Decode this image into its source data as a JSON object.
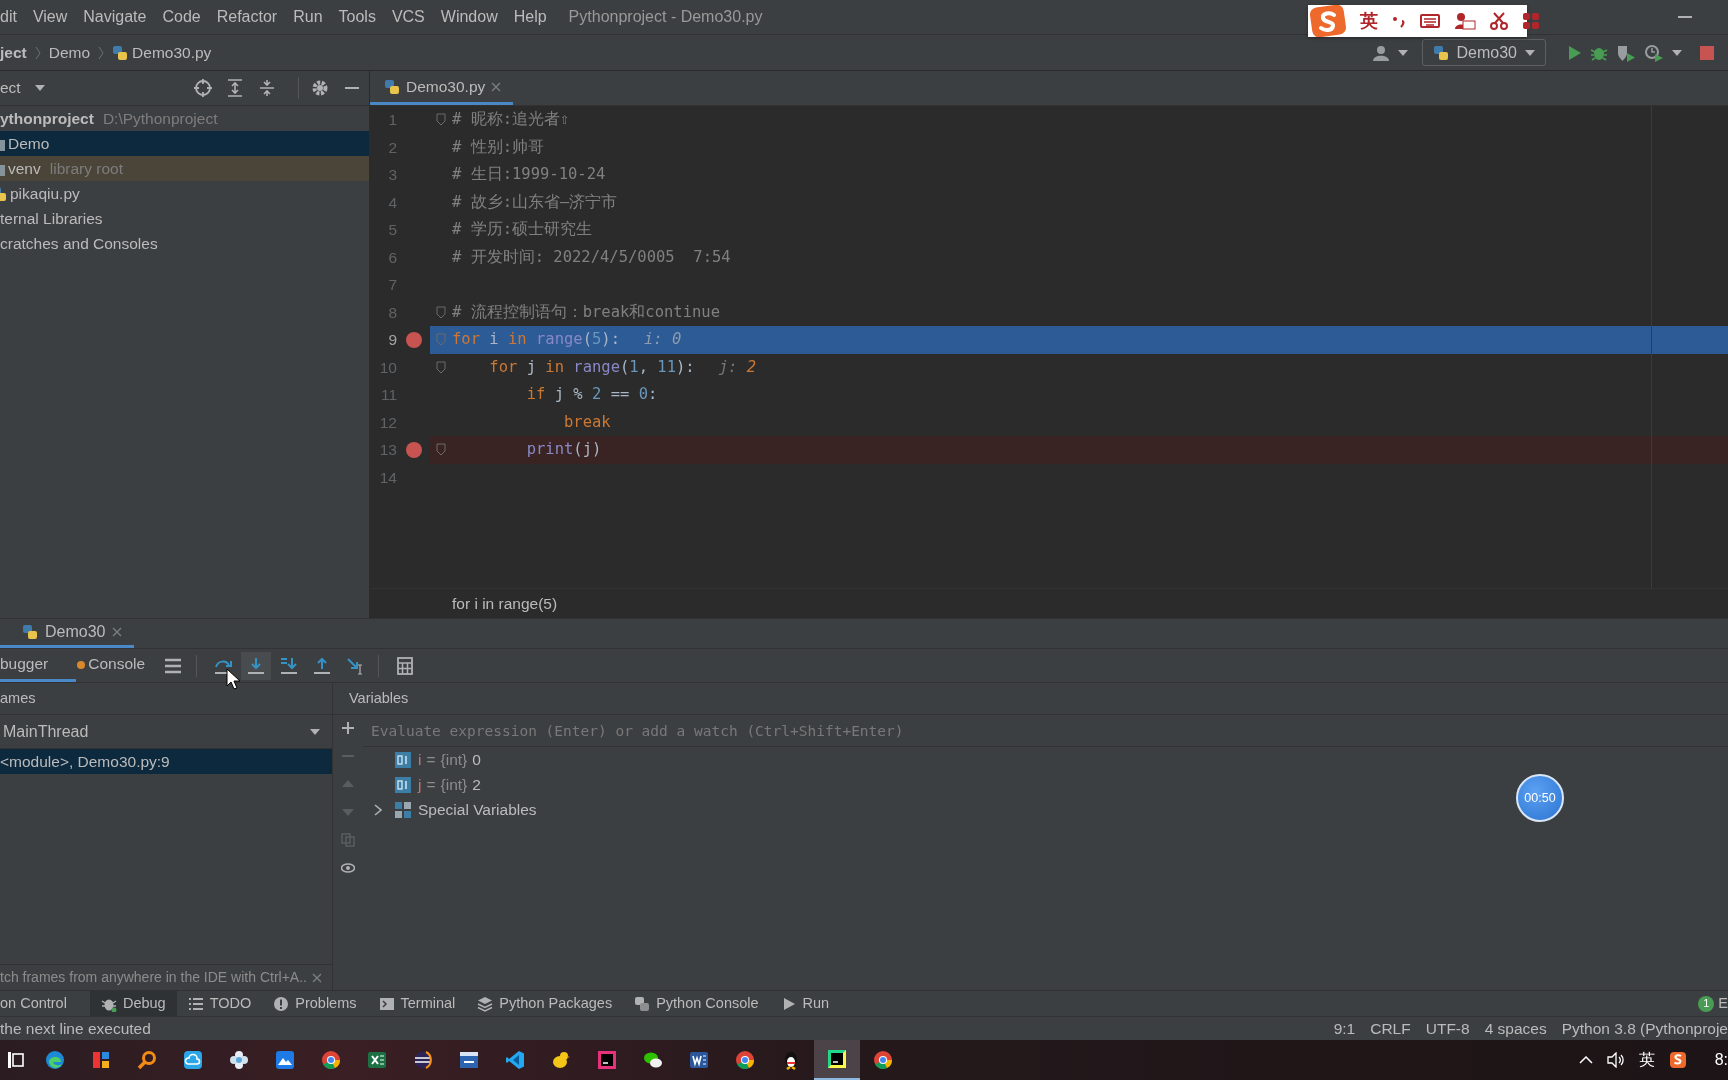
{
  "menu": [
    {
      "label": "dit"
    },
    {
      "label": "View"
    },
    {
      "label": "Navigate"
    },
    {
      "label": "Code"
    },
    {
      "label": "Refactor"
    },
    {
      "label": "Run"
    },
    {
      "label": "Tools"
    },
    {
      "label": "VCS"
    },
    {
      "label": "Window"
    },
    {
      "label": "Help"
    }
  ],
  "window_title": "Pythonproject - Demo30.py",
  "ime_toolbar": {
    "mode": "英"
  },
  "breadcrumbs": [
    {
      "label": "ject",
      "kind": "project"
    },
    {
      "label": "Demo",
      "kind": "folder"
    },
    {
      "label": "Demo30.py",
      "kind": "file"
    }
  ],
  "run_configuration": "Demo30",
  "project_panel": {
    "title": "ect",
    "tree": [
      {
        "label": "ythonproject",
        "path": "D:\\Pythonproject",
        "kind": "project",
        "selected": false,
        "children": [
          {
            "label": "Demo",
            "kind": "folder",
            "selected": true
          },
          {
            "label": "venv",
            "note": "library root",
            "kind": "library",
            "selected": false
          },
          {
            "label": "pikaqiu.py",
            "kind": "file",
            "selected": false
          }
        ]
      },
      {
        "label": "ternal Libraries",
        "kind": "libraries",
        "selected": false
      },
      {
        "label": "cratches and Consoles",
        "kind": "scratches",
        "selected": false
      }
    ]
  },
  "editor": {
    "tabs": [
      {
        "label": "Demo30.py",
        "selected": true
      }
    ],
    "lines": [
      {
        "number": "1",
        "fold": true,
        "breakpoint": false,
        "current": false,
        "code": [
          {
            "kind": "comment",
            "text": "# 昵称:追光者⇧"
          }
        ]
      },
      {
        "number": "2",
        "fold": false,
        "breakpoint": false,
        "current": false,
        "code": [
          {
            "kind": "comment",
            "text": "# 性别:帅哥"
          }
        ]
      },
      {
        "number": "3",
        "fold": false,
        "breakpoint": false,
        "current": false,
        "code": [
          {
            "kind": "comment",
            "text": "# 生日:1999-10-24"
          }
        ]
      },
      {
        "number": "4",
        "fold": false,
        "breakpoint": false,
        "current": false,
        "code": [
          {
            "kind": "comment",
            "text": "# 故乡:山东省—济宁市"
          }
        ]
      },
      {
        "number": "5",
        "fold": false,
        "breakpoint": false,
        "current": false,
        "code": [
          {
            "kind": "comment",
            "text": "# 学历:硕士研究生"
          }
        ]
      },
      {
        "number": "6",
        "fold": false,
        "breakpoint": false,
        "current": false,
        "code": [
          {
            "kind": "comment",
            "text": "# 开发时间: 2022/4/5/0005  7:54"
          }
        ]
      },
      {
        "number": "7",
        "fold": false,
        "breakpoint": false,
        "current": false
      },
      {
        "number": "8",
        "fold": true,
        "breakpoint": false,
        "current": false,
        "code": [
          {
            "kind": "comment",
            "text": "# 流程控制语句：break和continue"
          }
        ]
      },
      {
        "number": "9",
        "fold": true,
        "breakpoint": true,
        "current": true,
        "code": [
          {
            "kind": "keyword",
            "text": "for"
          },
          {
            "kind": "plain",
            "text": " i "
          },
          {
            "kind": "keyword",
            "text": "in"
          },
          {
            "kind": "builtin",
            "text": " range"
          },
          {
            "kind": "plain",
            "text": "("
          },
          {
            "kind": "number",
            "text": "5"
          },
          {
            "kind": "plain",
            "text": "):"
          }
        ],
        "hint": {
          "name": "i: ",
          "value": "0"
        }
      },
      {
        "number": "10",
        "fold": true,
        "breakpoint": false,
        "current": false,
        "code": [
          {
            "kind": "keyword",
            "text": "    for"
          },
          {
            "kind": "plain",
            "text": " j "
          },
          {
            "kind": "keyword",
            "text": "in"
          },
          {
            "kind": "builtin",
            "text": " range"
          },
          {
            "kind": "plain",
            "text": "("
          },
          {
            "kind": "number",
            "text": "1"
          },
          {
            "kind": "plain",
            "text": ", "
          },
          {
            "kind": "number",
            "text": "11"
          },
          {
            "kind": "plain",
            "text": "):"
          }
        ],
        "hint": {
          "name": "j: ",
          "value": "2"
        }
      },
      {
        "number": "11",
        "fold": false,
        "breakpoint": false,
        "current": false,
        "code": [
          {
            "kind": "keyword",
            "text": "        if"
          },
          {
            "kind": "plain",
            "text": " j % "
          },
          {
            "kind": "number",
            "text": "2"
          },
          {
            "kind": "plain",
            "text": " == "
          },
          {
            "kind": "number",
            "text": "0"
          },
          {
            "kind": "plain",
            "text": ":"
          }
        ]
      },
      {
        "number": "12",
        "fold": false,
        "breakpoint": false,
        "current": false,
        "code": [
          {
            "kind": "keyword",
            "text": "            break"
          }
        ]
      },
      {
        "number": "13",
        "fold": true,
        "breakpoint": true,
        "current": false,
        "code": [
          {
            "kind": "builtin",
            "text": "        print"
          },
          {
            "kind": "plain",
            "text": "(j)"
          }
        ]
      },
      {
        "number": "14",
        "fold": false,
        "breakpoint": false,
        "current": false
      }
    ],
    "breadcrumb": "for i in range(5)"
  },
  "debug": {
    "tabs": [
      {
        "label": "Demo30",
        "selected": true
      }
    ],
    "subtabs": [
      {
        "label": "bugger",
        "selected": true
      },
      {
        "label": "Console",
        "selected": false
      }
    ],
    "frames_title": "ames",
    "thread": "MainThread",
    "frames": [
      {
        "label": "<module>, Demo30.py:9",
        "selected": true
      }
    ],
    "variables_title": "Variables",
    "evaluate": {
      "placeholder": "Evaluate expression (Enter) or add a watch (Ctrl+Shift+Enter)"
    },
    "variables": [
      {
        "kind": "value",
        "name": "i",
        "separator": "=",
        "type": "{int}",
        "value": "0"
      },
      {
        "kind": "value",
        "name": "j",
        "separator": "=",
        "type": "{int}",
        "value": "2"
      },
      {
        "kind": "group",
        "name": "Special Variables",
        "expanded": false
      }
    ],
    "hint": "tch frames from anywhere in the IDE with Ctrl+A.."
  },
  "timer": "00:50",
  "tool_windows": [
    {
      "label": "on Control",
      "kind": "vcs",
      "selected": false
    },
    {
      "label": "Debug",
      "kind": "debug",
      "selected": true
    },
    {
      "label": "TODO",
      "kind": "todo",
      "selected": false
    },
    {
      "label": "Problems",
      "kind": "problems",
      "selected": false
    },
    {
      "label": "Terminal",
      "kind": "terminal",
      "selected": false
    },
    {
      "label": "Python Packages",
      "kind": "packages",
      "selected": false
    },
    {
      "label": "Python Console",
      "kind": "console",
      "selected": false
    },
    {
      "label": "Run",
      "kind": "run",
      "selected": false
    }
  ],
  "event_log": {
    "count": "1",
    "label": "E"
  },
  "status": {
    "message": "the next line executed",
    "items": [
      "9:1",
      "CRLF",
      "UTF-8",
      "4 spaces",
      "Python 3.8 (Pythonproje"
    ]
  },
  "taskbar": {
    "apps": [
      {
        "kind": "taskview",
        "selected": false
      },
      {
        "kind": "edge",
        "selected": false
      },
      {
        "kind": "tiles",
        "selected": false
      },
      {
        "kind": "search",
        "selected": false
      },
      {
        "kind": "cloud",
        "selected": false
      },
      {
        "kind": "flower",
        "selected": false
      },
      {
        "kind": "boxapp",
        "selected": false
      },
      {
        "kind": "chrome",
        "selected": false
      },
      {
        "kind": "excel",
        "selected": false
      },
      {
        "kind": "eclipse",
        "selected": false
      },
      {
        "kind": "devcpp",
        "selected": false
      },
      {
        "kind": "vscode",
        "selected": false
      },
      {
        "kind": "yellowapp",
        "selected": false
      },
      {
        "kind": "intellij",
        "selected": false
      },
      {
        "kind": "wechat",
        "selected": false
      },
      {
        "kind": "word",
        "selected": false
      },
      {
        "kind": "chrome",
        "selected": false
      },
      {
        "kind": "qq",
        "selected": false
      },
      {
        "kind": "pycharm",
        "selected": true
      },
      {
        "kind": "chrome",
        "selected": false
      }
    ],
    "ime": "英",
    "clock": "8:"
  }
}
